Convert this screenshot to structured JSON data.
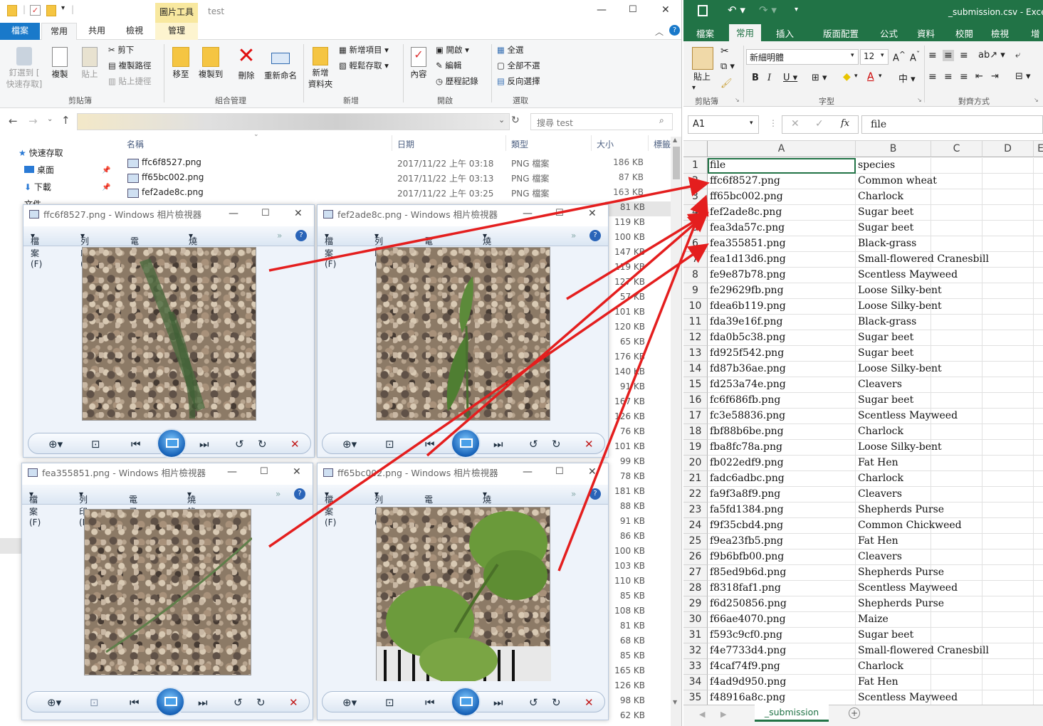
{
  "explorer": {
    "title_context_tab": "圖片工具",
    "title": "test",
    "tabs": {
      "file": "檔案",
      "home": "常用",
      "share": "共用",
      "view": "檢視",
      "manage": "管理"
    },
    "ribbon": {
      "pin": "釘選到 [\n快速存取]",
      "copy": "複製",
      "paste": "貼上",
      "cut": "剪下",
      "copy_path": "複製路徑",
      "paste_shortcut": "貼上捷徑",
      "group_clipboard": "剪貼簿",
      "move_to": "移至",
      "copy_to": "複製到",
      "delete": "刪除",
      "rename": "重新命名",
      "group_organize": "組合管理",
      "new_folder": "新增\n資料夾",
      "new_item": "新增項目",
      "easy_access": "輕鬆存取",
      "group_new": "新增",
      "properties": "內容",
      "open": "開啟",
      "edit": "編輯",
      "history": "歷程記錄",
      "group_open": "開啟",
      "select_all": "全選",
      "select_none": "全部不選",
      "invert": "反向選擇",
      "group_select": "選取"
    },
    "search_placeholder": "搜尋 test",
    "nav": {
      "quick_access": "快速存取",
      "desktop": "桌面",
      "downloads": "下載",
      "documents": "文件"
    },
    "columns": {
      "name": "名稱",
      "date": "日期",
      "type": "類型",
      "size": "大小",
      "tags": "標籤"
    },
    "files": [
      {
        "name": "ffc6f8527.png",
        "date": "2017/11/22 上午 03:18",
        "type": "PNG 檔案",
        "size": "186 KB"
      },
      {
        "name": "ff65bc002.png",
        "date": "2017/11/22 上午 03:13",
        "type": "PNG 檔案",
        "size": "87 KB"
      },
      {
        "name": "fef2ade8c.png",
        "date": "2017/11/22 上午 03:25",
        "type": "PNG 檔案",
        "size": "163 KB"
      }
    ],
    "sizes_more": [
      "81 KB",
      "119 KB",
      "100 KB",
      "147 KB",
      "119 KB",
      "127 KB",
      "57 KB",
      "101 KB",
      "120 KB",
      "65 KB",
      "176 KB",
      "140 KB",
      "91 KB",
      "167 KB",
      "126 KB",
      "76 KB",
      "101 KB",
      "99 KB",
      "78 KB",
      "181 KB",
      "88 KB",
      "91 KB",
      "86 KB",
      "100 KB",
      "103 KB",
      "110 KB",
      "85 KB",
      "108 KB",
      "81 KB",
      "68 KB",
      "85 KB",
      "165 KB",
      "126 KB",
      "98 KB",
      "62 KB"
    ]
  },
  "viewers": [
    {
      "title": "ffc6f8527.png - Windows 相片檢視器"
    },
    {
      "title": "fef2ade8c.png - Windows 相片檢視器"
    },
    {
      "title": "fea355851.png - Windows 相片檢視器"
    },
    {
      "title": "ff65bc002.png - Windows 相片檢視器"
    }
  ],
  "viewer_menu": {
    "file": "檔案(F)",
    "print": "列印(P)",
    "email": "電子郵件(E)",
    "burn": "燒錄(U)"
  },
  "excel": {
    "title": "_submission.csv - Excel",
    "tabs": [
      "檔案",
      "常用",
      "插入",
      "版面配置",
      "公式",
      "資料",
      "校閱",
      "檢視",
      "增益集"
    ],
    "font_name": "新細明體",
    "font_size": "12",
    "groups": {
      "clipboard": "剪貼簿",
      "font": "字型",
      "align": "對齊方式"
    },
    "paste": "貼上",
    "name_box": "A1",
    "formula": "file",
    "cols": [
      "A",
      "B",
      "C",
      "D",
      "E"
    ],
    "rows": [
      [
        "file",
        "species"
      ],
      [
        "ffc6f8527.png",
        "Common wheat"
      ],
      [
        "ff65bc002.png",
        "Charlock"
      ],
      [
        "fef2ade8c.png",
        "Sugar beet"
      ],
      [
        "fea3da57c.png",
        "Sugar beet"
      ],
      [
        "fea355851.png",
        "Black-grass"
      ],
      [
        "fea1d13d6.png",
        "Small-flowered Cranesbill"
      ],
      [
        "fe9e87b78.png",
        "Scentless Mayweed"
      ],
      [
        "fe29629fb.png",
        "Loose Silky-bent"
      ],
      [
        "fdea6b119.png",
        "Loose Silky-bent"
      ],
      [
        "fda39e16f.png",
        "Black-grass"
      ],
      [
        "fda0b5c38.png",
        "Sugar beet"
      ],
      [
        "fd925f542.png",
        "Sugar beet"
      ],
      [
        "fd87b36ae.png",
        "Loose Silky-bent"
      ],
      [
        "fd253a74e.png",
        "Cleavers"
      ],
      [
        "fc6f686fb.png",
        "Sugar beet"
      ],
      [
        "fc3e58836.png",
        "Scentless Mayweed"
      ],
      [
        "fbf88b6be.png",
        "Charlock"
      ],
      [
        "fba8fc78a.png",
        "Loose Silky-bent"
      ],
      [
        "fb022edf9.png",
        "Fat Hen"
      ],
      [
        "fadc6adbc.png",
        "Charlock"
      ],
      [
        "fa9f3a8f9.png",
        "Cleavers"
      ],
      [
        "fa5fd1384.png",
        "Shepherds Purse"
      ],
      [
        "f9f35cbd4.png",
        "Common Chickweed"
      ],
      [
        "f9ea23fb5.png",
        "Fat Hen"
      ],
      [
        "f9b6bfb00.png",
        "Cleavers"
      ],
      [
        "f85ed9b6d.png",
        "Shepherds Purse"
      ],
      [
        "f8318faf1.png",
        "Scentless Mayweed"
      ],
      [
        "f6d250856.png",
        "Shepherds Purse"
      ],
      [
        "f66ae4070.png",
        "Maize"
      ],
      [
        "f593c9cf0.png",
        "Sugar beet"
      ],
      [
        "f4e7733d4.png",
        "Small-flowered Cranesbill"
      ],
      [
        "f4caf74f9.png",
        "Charlock"
      ],
      [
        "f4ad9d950.png",
        "Fat Hen"
      ],
      [
        "f48916a8c.png",
        "Scentless Mayweed"
      ]
    ],
    "sheet_tab": "_submission"
  },
  "colors": {
    "excel_green": "#217346",
    "explorer_blue": "#1979ca",
    "arrow_red": "#e41e1e"
  }
}
